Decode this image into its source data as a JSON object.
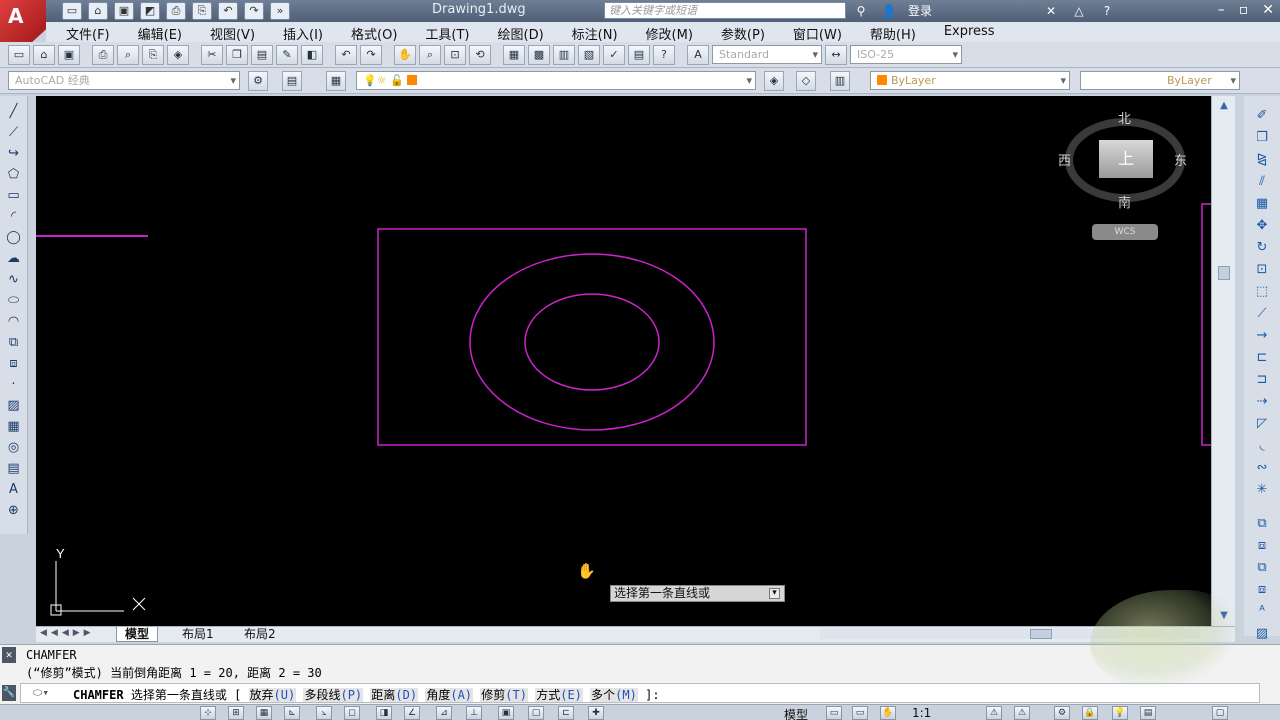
{
  "titlebar": {
    "doc_title": "Drawing1.dwg",
    "search_placeholder": "键入关键字或短语",
    "login_label": "登录",
    "express_label": "Express"
  },
  "menu": {
    "items": [
      "文件(F)",
      "编辑(E)",
      "视图(V)",
      "插入(I)",
      "格式(O)",
      "工具(T)",
      "绘图(D)",
      "标注(N)",
      "修改(M)",
      "参数(P)",
      "窗口(W)",
      "帮助(H)",
      "Express"
    ]
  },
  "toolbar1": {
    "text_style": "Standard",
    "dim_style": "ISO-25"
  },
  "toolbar2": {
    "workspace": "AutoCAD 经典",
    "color": "ByLayer",
    "linetype": "ByLayer"
  },
  "viewcube": {
    "north": "北",
    "south": "南",
    "east": "东",
    "west": "西",
    "top_face": "上",
    "wcs": "WCS"
  },
  "ucs": {
    "y_label": "Y"
  },
  "tabs": {
    "model": "模型",
    "layout1": "布局1",
    "layout2": "布局2"
  },
  "cursor_tip": "选择第一条直线或",
  "command": {
    "line1": "CHAMFER",
    "line2": "(“修剪”模式) 当前倒角距离 1 = 20, 距离 2 = 30",
    "cmd_name": "CHAMFER",
    "prompt": "选择第一条直线或",
    "options": [
      {
        "label": "放弃",
        "key": "(U)"
      },
      {
        "label": "多段线",
        "key": "(P)"
      },
      {
        "label": "距离",
        "key": "(D)"
      },
      {
        "label": "角度",
        "key": "(A)"
      },
      {
        "label": "修剪",
        "key": "(T)"
      },
      {
        "label": "方式",
        "key": "(E)"
      },
      {
        "label": "多个",
        "key": "(M)"
      }
    ],
    "end": "]:"
  },
  "statusbar": {
    "model_label": "模型",
    "scale": "1:1"
  },
  "colors": {
    "canvas_bg": "#000000",
    "geometry": "#cc22cc",
    "ucs": "#ffffff"
  }
}
